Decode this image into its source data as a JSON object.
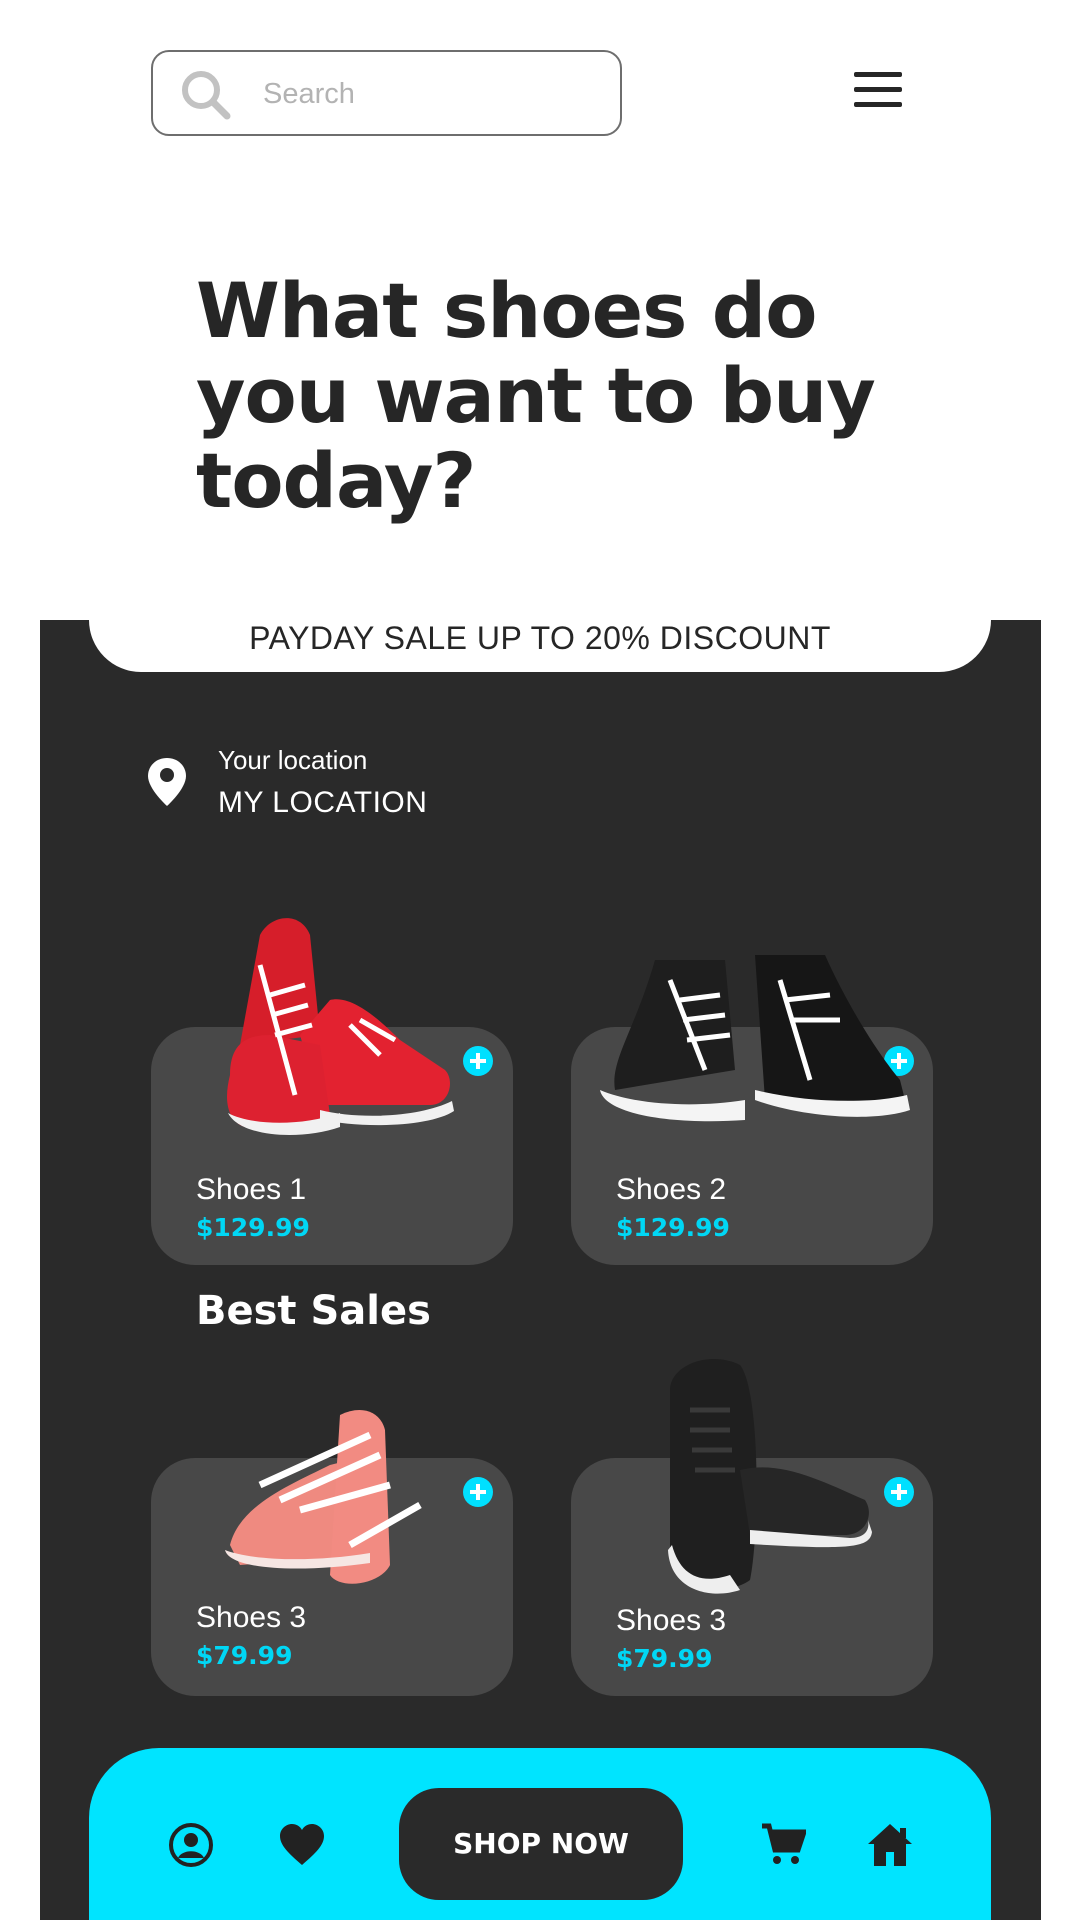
{
  "search": {
    "placeholder": "Search"
  },
  "headline": "What shoes do you want to buy today?",
  "promo_banner": "PAYDAY SALE UP TO 20% DISCOUNT",
  "location": {
    "label": "Your location",
    "value": "MY LOCATION"
  },
  "featured_products": [
    {
      "name": "Shoes 1",
      "price": "$129.99"
    },
    {
      "name": "Shoes 2",
      "price": "$129.99"
    }
  ],
  "best_sales": {
    "title": "Best Sales",
    "products": [
      {
        "name": "Shoes 3",
        "price": "$79.99"
      },
      {
        "name": "Shoes 3",
        "price": "$79.99"
      }
    ]
  },
  "bottom_nav": {
    "cta_label": "SHOP NOW",
    "icons": [
      "user-icon",
      "heart-icon",
      "cart-icon",
      "home-icon"
    ]
  },
  "colors": {
    "accent": "#00e4ff",
    "dark_panel": "#2a2a2a",
    "card": "#484848",
    "price": "#00d7f5"
  }
}
